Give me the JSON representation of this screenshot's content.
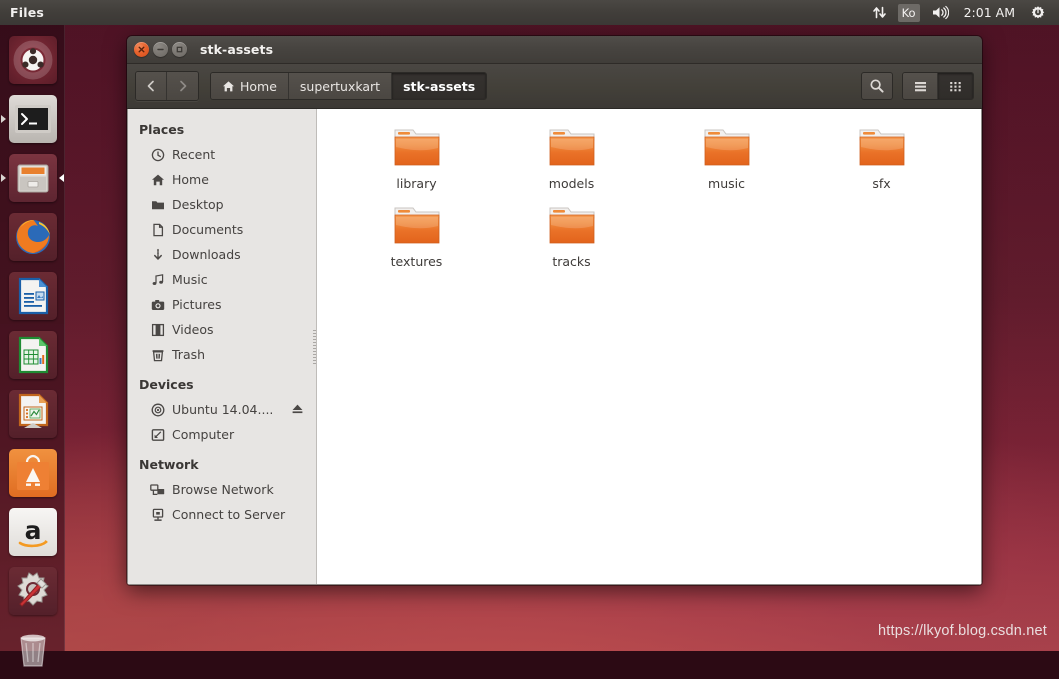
{
  "top_panel": {
    "app_title": "Files",
    "indicators": {
      "network_icon": "network-up-down-icon",
      "keyboard_layout": "Ko",
      "volume_icon": "volume-icon",
      "clock": "2:01 AM",
      "session_icon": "gear-power-icon"
    }
  },
  "launcher": {
    "items": [
      {
        "name": "ubuntu-dash",
        "label": "Ubuntu Dash"
      },
      {
        "name": "terminal",
        "label": "Terminal"
      },
      {
        "name": "files",
        "label": "Files"
      },
      {
        "name": "firefox",
        "label": "Firefox"
      },
      {
        "name": "libreoffice-writer",
        "label": "LibreOffice Writer"
      },
      {
        "name": "libreoffice-calc",
        "label": "LibreOffice Calc"
      },
      {
        "name": "libreoffice-impress",
        "label": "LibreOffice Impress"
      },
      {
        "name": "ubuntu-software-center",
        "label": "Ubuntu Software Center"
      },
      {
        "name": "amazon",
        "label": "Amazon"
      },
      {
        "name": "system-settings",
        "label": "System Settings"
      },
      {
        "name": "trash",
        "label": "Trash"
      }
    ]
  },
  "window": {
    "title": "stk-assets",
    "controls": {
      "close": "close-button",
      "minimize": "minimize-button",
      "maximize": "maximize-button"
    },
    "toolbar": {
      "back_label": "Back",
      "forward_label": "Forward",
      "search_label": "Search",
      "list_view_label": "List view",
      "grid_view_label": "Icon view",
      "active_view": "grid"
    },
    "breadcrumb": [
      {
        "label": "Home",
        "icon": "home-icon",
        "active": false
      },
      {
        "label": "supertuxkart",
        "icon": "",
        "active": false
      },
      {
        "label": "stk-assets",
        "icon": "",
        "active": true
      }
    ]
  },
  "sidebar": {
    "sections": [
      {
        "title": "Places",
        "items": [
          {
            "label": "Recent",
            "icon": "clock-icon"
          },
          {
            "label": "Home",
            "icon": "home-icon"
          },
          {
            "label": "Desktop",
            "icon": "folder-icon"
          },
          {
            "label": "Documents",
            "icon": "document-icon"
          },
          {
            "label": "Downloads",
            "icon": "download-arrow-icon"
          },
          {
            "label": "Music",
            "icon": "music-note-icon"
          },
          {
            "label": "Pictures",
            "icon": "camera-icon"
          },
          {
            "label": "Videos",
            "icon": "film-icon"
          },
          {
            "label": "Trash",
            "icon": "trash-icon"
          }
        ]
      },
      {
        "title": "Devices",
        "items": [
          {
            "label": "Ubuntu 14.04....",
            "icon": "disc-icon",
            "eject": true
          },
          {
            "label": "Computer",
            "icon": "computer-icon"
          }
        ]
      },
      {
        "title": "Network",
        "items": [
          {
            "label": "Browse Network",
            "icon": "network-browse-icon"
          },
          {
            "label": "Connect to Server",
            "icon": "server-connect-icon"
          }
        ]
      }
    ]
  },
  "content": {
    "files": [
      {
        "name": "library",
        "type": "folder"
      },
      {
        "name": "models",
        "type": "folder"
      },
      {
        "name": "music",
        "type": "folder"
      },
      {
        "name": "sfx",
        "type": "folder"
      },
      {
        "name": "textures",
        "type": "folder"
      },
      {
        "name": "tracks",
        "type": "folder"
      }
    ]
  },
  "watermark": {
    "text": "https://lkyof.blog.csdn.net"
  },
  "colors": {
    "panel_bg": "#413e3a",
    "titlebar_bg": "#474440",
    "sidebar_bg": "#e7e5e3",
    "content_bg": "#ffffff",
    "folder_orange": "#e8702a",
    "close_button": "#e8622c",
    "launcher_bg": "#3e101c"
  }
}
